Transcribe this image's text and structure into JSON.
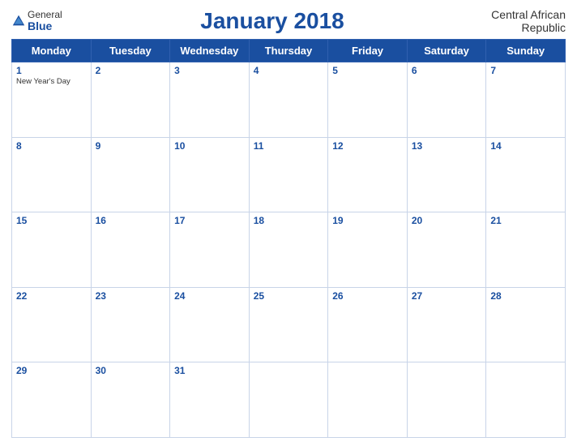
{
  "header": {
    "logo_general": "General",
    "logo_blue": "Blue",
    "title": "January 2018",
    "country": "Central African Republic"
  },
  "weekdays": [
    "Monday",
    "Tuesday",
    "Wednesday",
    "Thursday",
    "Friday",
    "Saturday",
    "Sunday"
  ],
  "weeks": [
    {
      "style": "blue",
      "days": [
        {
          "num": "1",
          "holiday": "New Year's Day"
        },
        {
          "num": "2",
          "holiday": ""
        },
        {
          "num": "3",
          "holiday": ""
        },
        {
          "num": "4",
          "holiday": ""
        },
        {
          "num": "5",
          "holiday": ""
        },
        {
          "num": "6",
          "holiday": ""
        },
        {
          "num": "7",
          "holiday": ""
        }
      ]
    },
    {
      "style": "white",
      "days": [
        {
          "num": "8",
          "holiday": ""
        },
        {
          "num": "9",
          "holiday": ""
        },
        {
          "num": "10",
          "holiday": ""
        },
        {
          "num": "11",
          "holiday": ""
        },
        {
          "num": "12",
          "holiday": ""
        },
        {
          "num": "13",
          "holiday": ""
        },
        {
          "num": "14",
          "holiday": ""
        }
      ]
    },
    {
      "style": "blue",
      "days": [
        {
          "num": "15",
          "holiday": ""
        },
        {
          "num": "16",
          "holiday": ""
        },
        {
          "num": "17",
          "holiday": ""
        },
        {
          "num": "18",
          "holiday": ""
        },
        {
          "num": "19",
          "holiday": ""
        },
        {
          "num": "20",
          "holiday": ""
        },
        {
          "num": "21",
          "holiday": ""
        }
      ]
    },
    {
      "style": "white",
      "days": [
        {
          "num": "22",
          "holiday": ""
        },
        {
          "num": "23",
          "holiday": ""
        },
        {
          "num": "24",
          "holiday": ""
        },
        {
          "num": "25",
          "holiday": ""
        },
        {
          "num": "26",
          "holiday": ""
        },
        {
          "num": "27",
          "holiday": ""
        },
        {
          "num": "28",
          "holiday": ""
        }
      ]
    },
    {
      "style": "blue",
      "days": [
        {
          "num": "29",
          "holiday": ""
        },
        {
          "num": "30",
          "holiday": ""
        },
        {
          "num": "31",
          "holiday": ""
        },
        {
          "num": "",
          "holiday": ""
        },
        {
          "num": "",
          "holiday": ""
        },
        {
          "num": "",
          "holiday": ""
        },
        {
          "num": "",
          "holiday": ""
        }
      ]
    }
  ]
}
